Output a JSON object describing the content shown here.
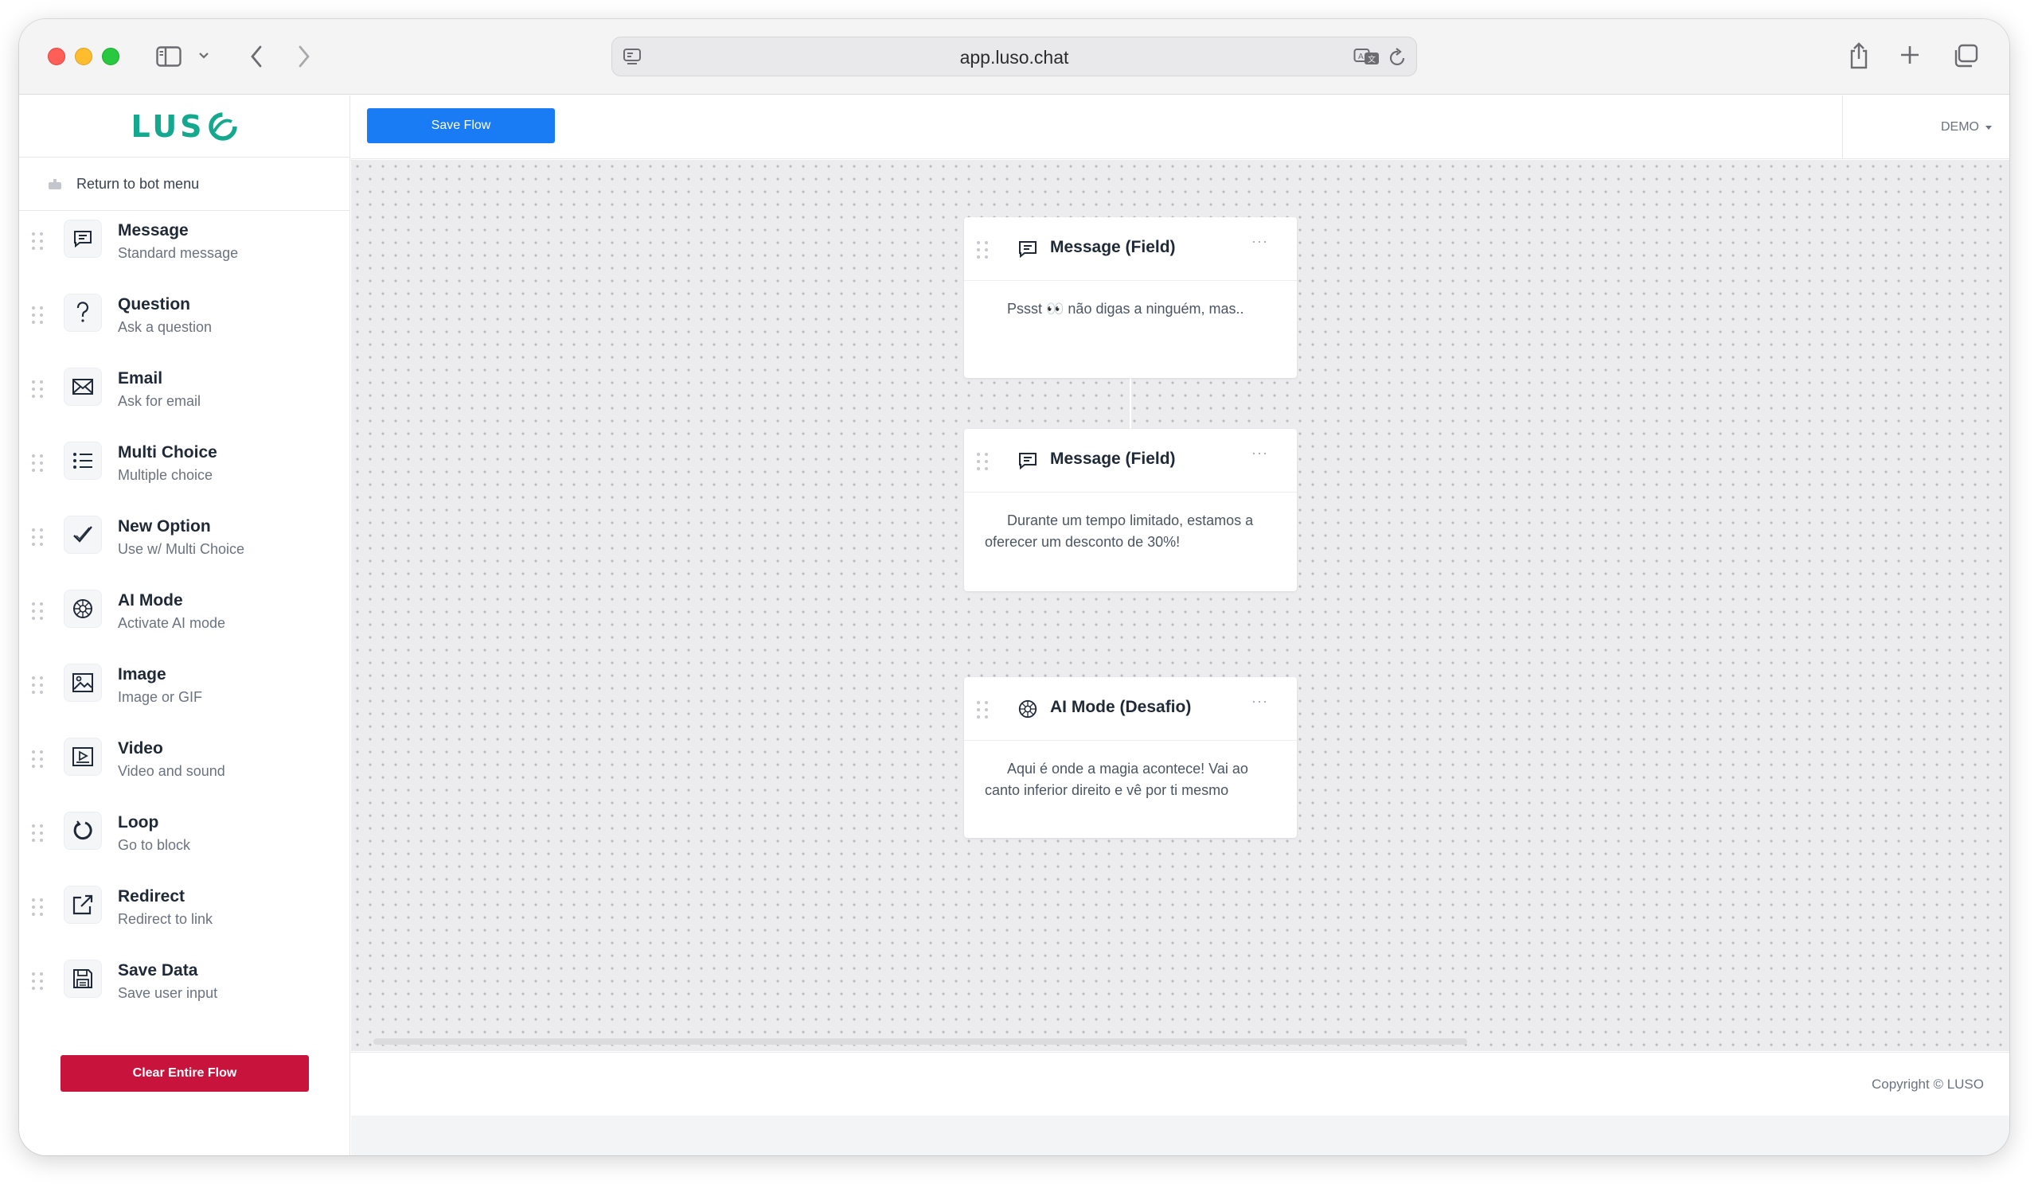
{
  "browser": {
    "url": "app.luso.chat"
  },
  "sidebar": {
    "logo": "LUS",
    "return_label": "Return to bot menu",
    "blocks": [
      {
        "title": "Message",
        "subtitle": "Standard message",
        "icon": "message-icon"
      },
      {
        "title": "Question",
        "subtitle": "Ask a question",
        "icon": "question-icon"
      },
      {
        "title": "Email",
        "subtitle": "Ask for email",
        "icon": "email-icon"
      },
      {
        "title": "Multi Choice",
        "subtitle": "Multiple choice",
        "icon": "list-icon"
      },
      {
        "title": "New Option",
        "subtitle": "Use w/ Multi Choice",
        "icon": "check-icon"
      },
      {
        "title": "AI Mode",
        "subtitle": "Activate AI mode",
        "icon": "ai-icon"
      },
      {
        "title": "Image",
        "subtitle": "Image or GIF",
        "icon": "image-icon"
      },
      {
        "title": "Video",
        "subtitle": "Video and sound",
        "icon": "video-icon"
      },
      {
        "title": "Loop",
        "subtitle": "Go to block",
        "icon": "loop-icon"
      },
      {
        "title": "Redirect",
        "subtitle": "Redirect to link",
        "icon": "redirect-icon"
      },
      {
        "title": "Save Data",
        "subtitle": "Save user input",
        "icon": "save-icon"
      }
    ],
    "clear_label": "Clear Entire Flow"
  },
  "topbar": {
    "save_label": "Save Flow",
    "account_label": "DEMO"
  },
  "flow": {
    "nodes": [
      {
        "title": "Message (Field)",
        "icon": "message-icon",
        "menu": "···",
        "text": "Pssst 👀 não digas a ninguém, mas.."
      },
      {
        "title": "Message (Field)",
        "icon": "message-icon",
        "menu": "···",
        "text": "Durante um tempo limitado, estamos a oferecer um desconto de 30%!"
      },
      {
        "title": "AI Mode (Desafio)",
        "icon": "ai-icon",
        "menu": "···",
        "text": "Aqui é onde a magia acontece! Vai ao canto inferior direito e vê por ti mesmo"
      }
    ]
  },
  "footer": {
    "copyright": "Copyright © LUSO"
  }
}
